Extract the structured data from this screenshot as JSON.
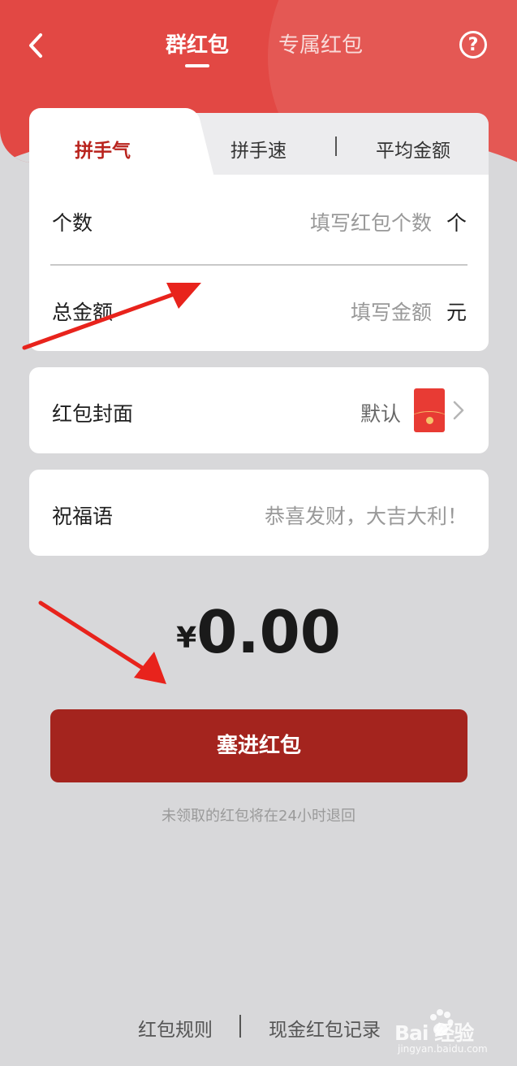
{
  "header": {
    "tabs": [
      {
        "label": "群红包",
        "active": true
      },
      {
        "label": "专属红包",
        "active": false
      }
    ],
    "help_glyph": "?"
  },
  "packet_types": [
    {
      "label": "拼手气",
      "active": true
    },
    {
      "label": "拼手速",
      "active": false
    },
    {
      "label": "平均金额",
      "active": false
    }
  ],
  "form": {
    "count": {
      "label": "个数",
      "placeholder": "填写红包个数",
      "unit": "个"
    },
    "total": {
      "label": "总金额",
      "placeholder": "填写金额",
      "unit": "元"
    }
  },
  "cover": {
    "label": "红包封面",
    "value": "默认"
  },
  "wish": {
    "label": "祝福语",
    "placeholder": "恭喜发财，大吉大利！"
  },
  "amount": {
    "currency": "¥",
    "value": "0.00"
  },
  "submit_label": "塞进红包",
  "notice": "未领取的红包将在24小时退回",
  "footer": {
    "rules": "红包规则",
    "records": "现金红包记录"
  },
  "watermark": {
    "logo": "Bai  经验",
    "url": "jingyan.baidu.com"
  },
  "colors": {
    "header_red": "#e24844",
    "button_red": "#a4241e",
    "active_tab_red": "#b9231d",
    "page_bg": "#d8d8da",
    "arrow_red": "#e8231c"
  },
  "icons": [
    "back-icon",
    "help-icon",
    "chevron-right-icon",
    "baidu-paw-icon"
  ]
}
